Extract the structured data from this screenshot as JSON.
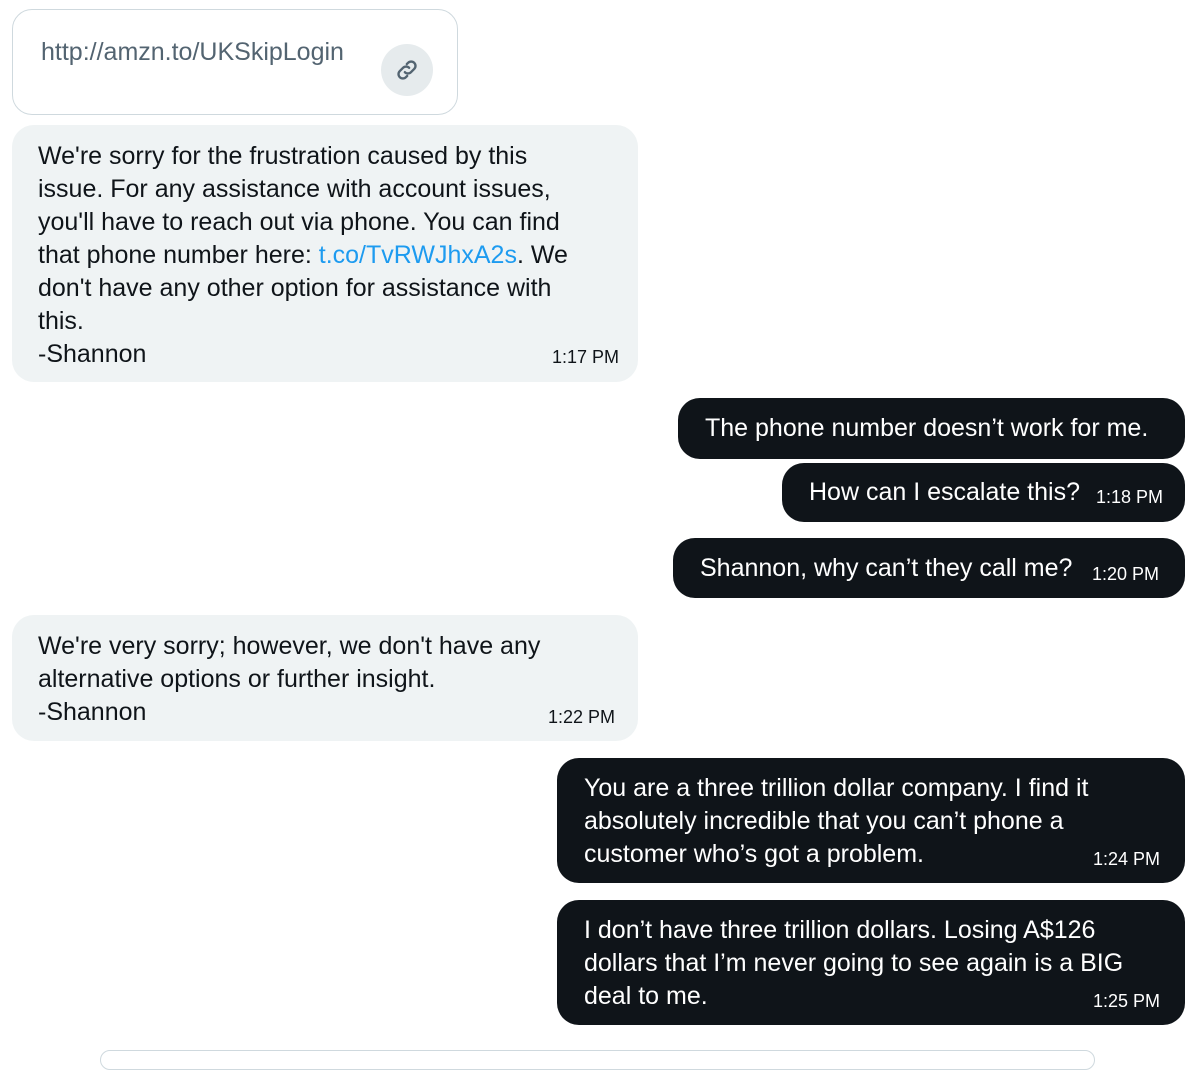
{
  "link_card": {
    "url": "http://amzn.to/UKSkipLogin",
    "icon": "link-icon"
  },
  "messages": [
    {
      "sender": "support",
      "text_before_link": "We're sorry for the frustration caused by this\nissue. For any assistance with account issues,\nyou'll have to reach out via phone. You can find\nthat phone number here: ",
      "link": "t.co/TvRWJhxA2s",
      "text_after_link": ". We\ndon't have any other option for assistance with\nthis.\n-Shannon",
      "time": "1:17 PM"
    },
    {
      "sender": "me",
      "text": "The phone number doesn’t work for me.",
      "time": ""
    },
    {
      "sender": "me",
      "text": "How can I escalate this?",
      "time": "1:18 PM"
    },
    {
      "sender": "me",
      "text": "Shannon, why can’t they call me?",
      "time": "1:20 PM"
    },
    {
      "sender": "support",
      "text": "We're very sorry; however, we don't have any\nalternative options or further insight.\n-Shannon",
      "time": "1:22 PM"
    },
    {
      "sender": "me",
      "text": "You are a three trillion dollar company. I find it\nabsolutely incredible that you can’t phone a\ncustomer who’s got a problem.",
      "time": "1:24 PM"
    },
    {
      "sender": "me",
      "text": "I don’t have three trillion dollars. Losing A$126\ndollars that I’m never going to see again is a BIG\ndeal to me.",
      "time": "1:25 PM"
    }
  ],
  "colors": {
    "incoming_bubble": "#eff3f4",
    "outgoing_bubble": "#0f1419",
    "link": "#1d9bf0",
    "border": "#cfd9de"
  }
}
